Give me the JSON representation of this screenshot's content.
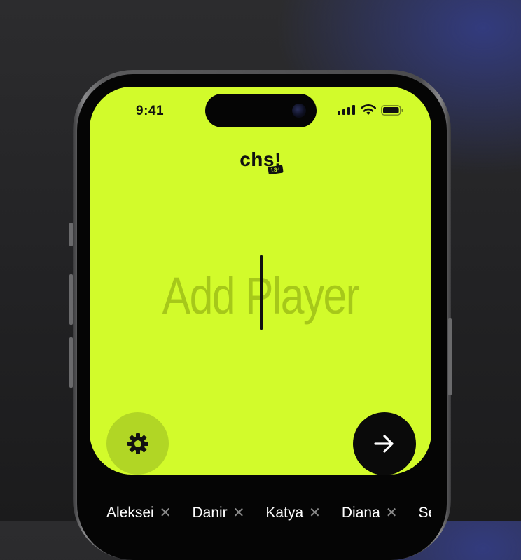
{
  "status_bar": {
    "time": "9:41"
  },
  "app": {
    "logo": "chs!",
    "age_rating": "18+"
  },
  "input": {
    "placeholder": "Add Player"
  },
  "icons": {
    "settings": "gear-icon",
    "next": "arrow-right-icon",
    "remove": "close-icon",
    "signal": "cellular-signal-icon",
    "wifi": "wifi-icon",
    "battery": "battery-icon"
  },
  "players": [
    {
      "name": "Aleksei"
    },
    {
      "name": "Danir"
    },
    {
      "name": "Katya"
    },
    {
      "name": "Diana"
    },
    {
      "name": "Se"
    }
  ],
  "colors": {
    "accent": "#d2fb2b",
    "button_dark": "#0a0a0a",
    "settings_bg": "#b1d625"
  }
}
